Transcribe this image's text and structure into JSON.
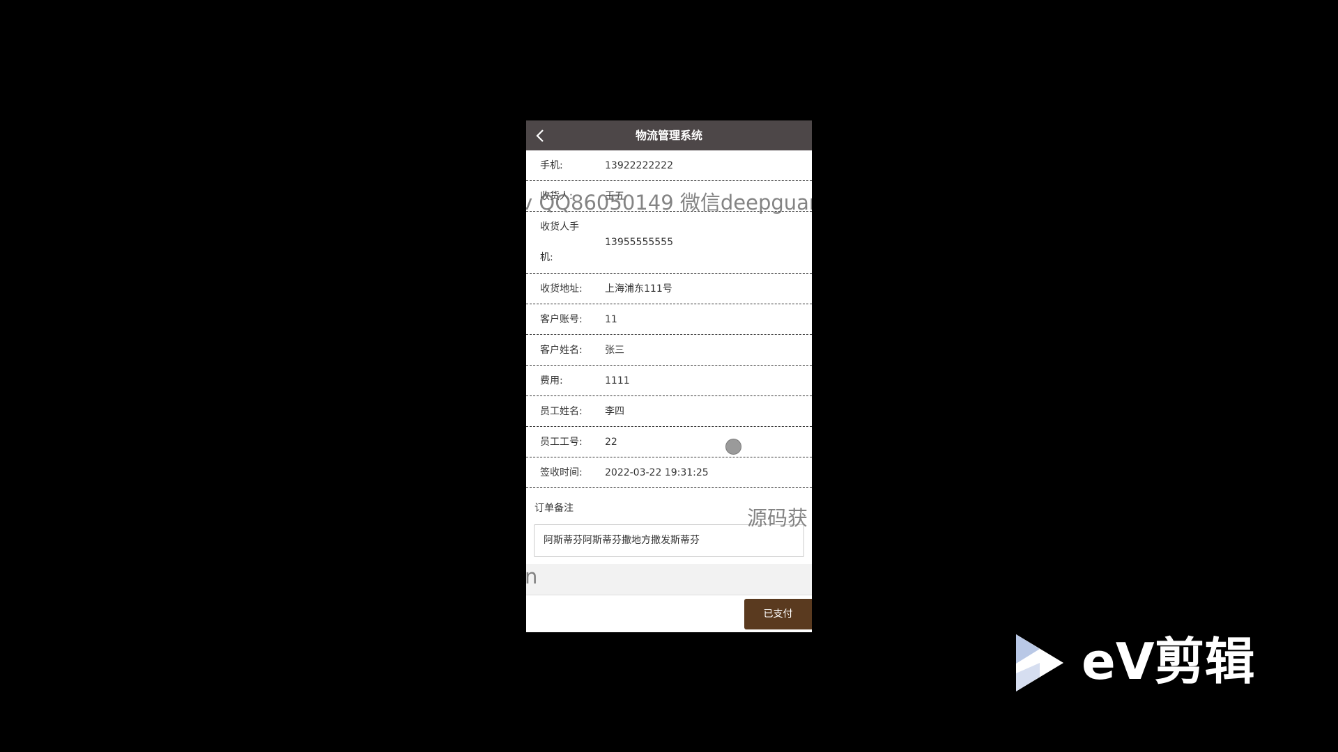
{
  "header": {
    "title": "物流管理系统",
    "back_icon": "chevron-left-icon"
  },
  "rows": [
    {
      "label": "手机:",
      "value": "13922222222"
    },
    {
      "label": "收货人:",
      "value": "王五"
    },
    {
      "label_line1": "收货人手",
      "label_line2": "机:",
      "value": "13955555555"
    },
    {
      "label": "收货地址:",
      "value": "上海浦东111号"
    },
    {
      "label": "客户账号:",
      "value": "11"
    },
    {
      "label": "客户姓名:",
      "value": "张三"
    },
    {
      "label": "费用:",
      "value": "1111"
    },
    {
      "label": "员工姓名:",
      "value": "李四"
    },
    {
      "label": "员工工号:",
      "value": "22"
    },
    {
      "label": "签收时间:",
      "value": "2022-03-22 19:31:25"
    }
  ],
  "remark": {
    "label": "订单备注",
    "value": "阿斯蒂芬阿斯蒂芬撒地方撒发斯蒂芬"
  },
  "footer": {
    "pay_button_label": "已支付"
  },
  "watermarks": {
    "line1": "v QQ86050149 微信deepguar",
    "line2": "源码获",
    "line3": "n"
  },
  "branding": {
    "logo_text": "eV剪辑",
    "logo_icon": "play-triangle-icon"
  },
  "colors": {
    "topbar": "#4d4748",
    "pay_button": "#5a3a1f",
    "background": "#000000"
  }
}
